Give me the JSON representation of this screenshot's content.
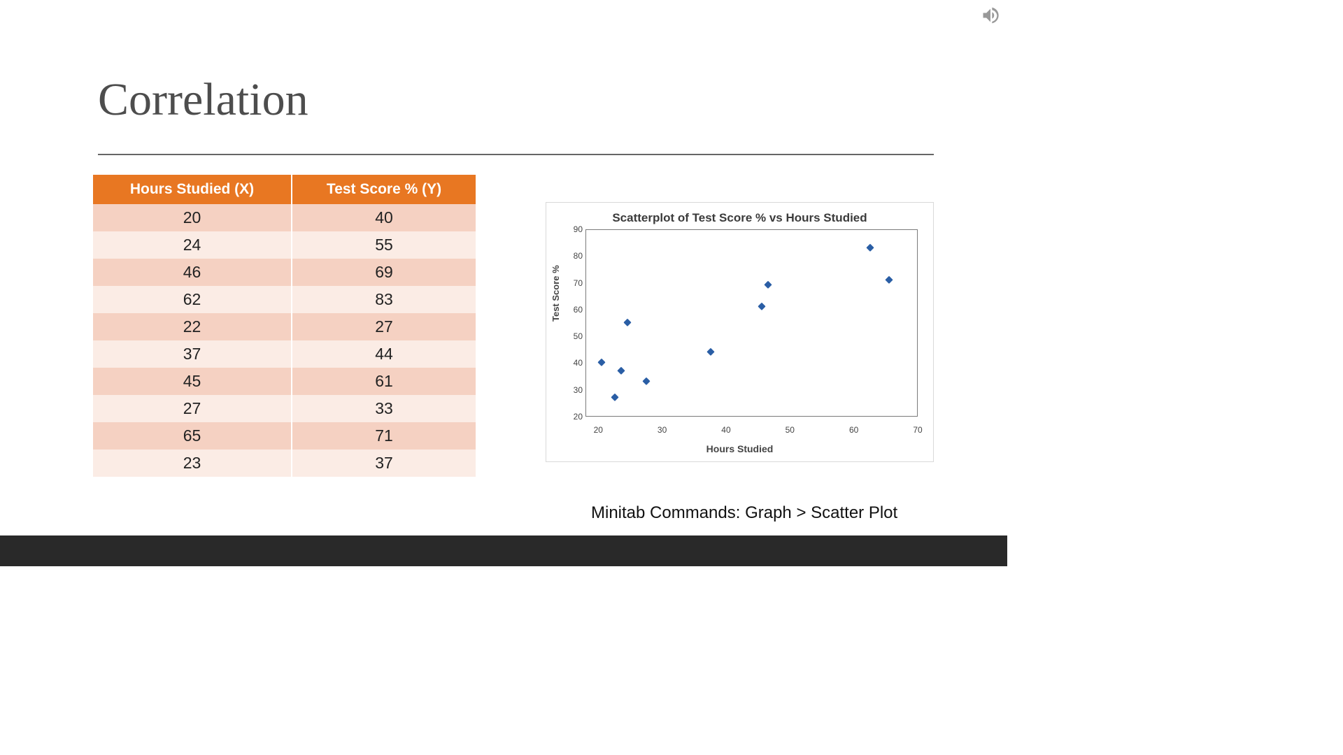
{
  "title": "Correlation",
  "table": {
    "headers": [
      "Hours Studied (X)",
      "Test Score % (Y)"
    ],
    "rows": [
      [
        "20",
        "40"
      ],
      [
        "24",
        "55"
      ],
      [
        "46",
        "69"
      ],
      [
        "62",
        "83"
      ],
      [
        "22",
        "27"
      ],
      [
        "37",
        "44"
      ],
      [
        "45",
        "61"
      ],
      [
        "27",
        "33"
      ],
      [
        "65",
        "71"
      ],
      [
        "23",
        "37"
      ]
    ]
  },
  "caption": "Minitab Commands: Graph > Scatter Plot",
  "chart_data": {
    "type": "scatter",
    "title": "Scatterplot of Test Score % vs Hours Studied",
    "xlabel": "Hours Studied",
    "ylabel": "Test Score %",
    "xlim": [
      18,
      70
    ],
    "ylim": [
      20,
      90
    ],
    "xticks": [
      20,
      30,
      40,
      50,
      60,
      70
    ],
    "yticks": [
      20,
      30,
      40,
      50,
      60,
      70,
      80,
      90
    ],
    "x": [
      20,
      24,
      46,
      62,
      22,
      37,
      45,
      27,
      65,
      23
    ],
    "y": [
      40,
      55,
      69,
      83,
      27,
      44,
      61,
      33,
      71,
      37
    ]
  }
}
